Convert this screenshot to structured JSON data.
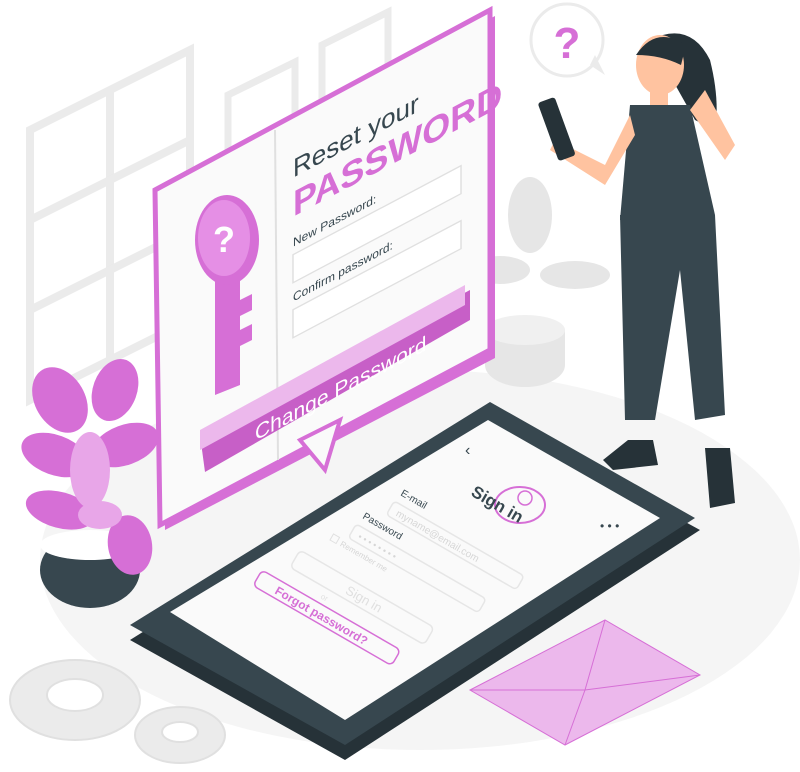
{
  "reset_panel": {
    "title_line1": "Reset your",
    "title_line2": "PASSWORD",
    "new_password_label": "New Password:",
    "confirm_password_label": "Confirm password:",
    "change_button": "Change Password",
    "key_symbol": "?"
  },
  "phone": {
    "back_symbol": "‹",
    "menu_symbol": "• • •",
    "title": "Sign in",
    "email_label": "E-mail",
    "email_placeholder": "myname@email.com",
    "password_label": "Password",
    "password_value": "• • • • • • • •",
    "remember_label": "Remember me",
    "sign_in_button": "Sign in",
    "or_label": "or",
    "forgot_link": "Forgot password?"
  },
  "thought_bubble": {
    "symbol": "?"
  },
  "colors": {
    "accent": "#d66fd6",
    "accent_light": "#ecb8ec",
    "dark": "#37474f",
    "grey": "#ebebeb"
  }
}
